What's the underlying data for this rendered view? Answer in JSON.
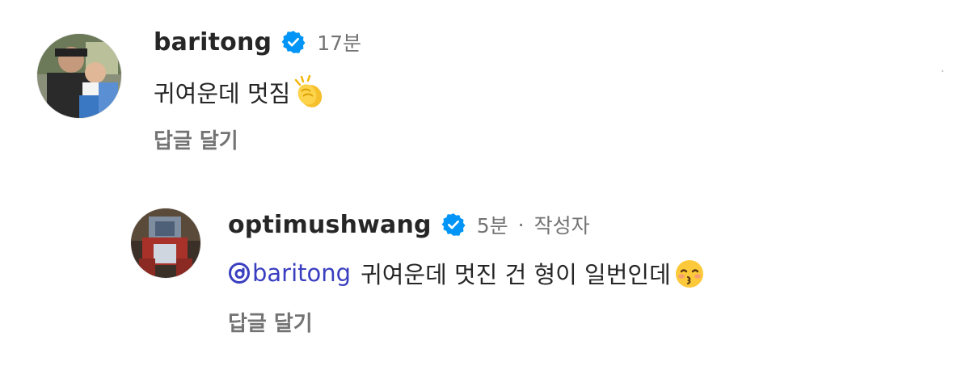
{
  "comments": [
    {
      "username": "baritong",
      "verified": true,
      "time": "17분",
      "text": "귀여운데 멋짐",
      "emoji": "clapping-hands",
      "reply_label": "답글 달기"
    },
    {
      "username": "optimushwang",
      "verified": true,
      "time": "5분",
      "separator": "·",
      "author_label": "작성자",
      "mention": "baritong",
      "text": "귀여운데 멋진 건 형이 일번인데",
      "emoji": "kissing-face-closed-eyes",
      "reply_label": "답글 달기"
    }
  ],
  "colors": {
    "username": "#262626",
    "meta": "#737373",
    "verified": "#0095f6",
    "mention": "#3a3fc0"
  }
}
